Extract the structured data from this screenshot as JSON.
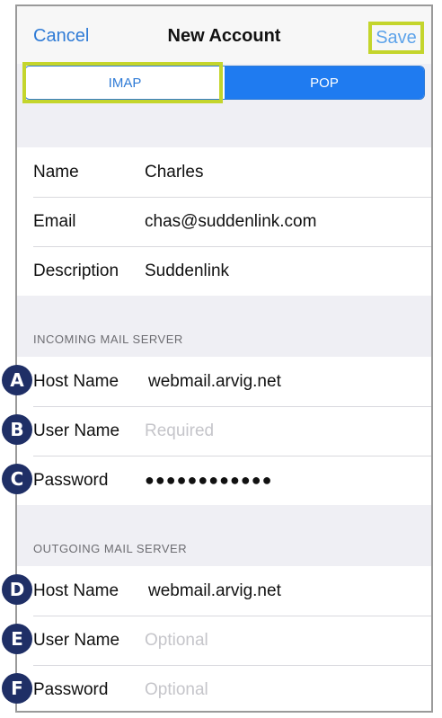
{
  "navbar": {
    "cancel_label": "Cancel",
    "title": "New Account",
    "save_label": "Save"
  },
  "segment": {
    "imap_label": "IMAP",
    "pop_label": "POP",
    "selected": "POP"
  },
  "account": {
    "name_label": "Name",
    "name_value": "Charles",
    "email_label": "Email",
    "email_value": "chas@suddenlink.com",
    "description_label": "Description",
    "description_value": "Suddenlink"
  },
  "incoming": {
    "header": "INCOMING MAIL SERVER",
    "host_label": "Host Name",
    "host_value": "webmail.arvig.net",
    "user_label": "User Name",
    "user_placeholder": "Required",
    "password_label": "Password",
    "password_value": "●●●●●●●●●●●●"
  },
  "outgoing": {
    "header": "OUTGOING MAIL SERVER",
    "host_label": "Host Name",
    "host_value": "webmail.arvig.net",
    "user_label": "User Name",
    "user_placeholder": "Optional",
    "password_label": "Password",
    "password_placeholder": "Optional"
  },
  "callouts": [
    "A",
    "B",
    "C",
    "D",
    "E",
    "F"
  ],
  "colors": {
    "accent_blue": "#2f7bd6",
    "highlight_green": "#c4d52c",
    "badge_navy": "#1f2f66",
    "placeholder_gray": "#c5c5ca"
  }
}
